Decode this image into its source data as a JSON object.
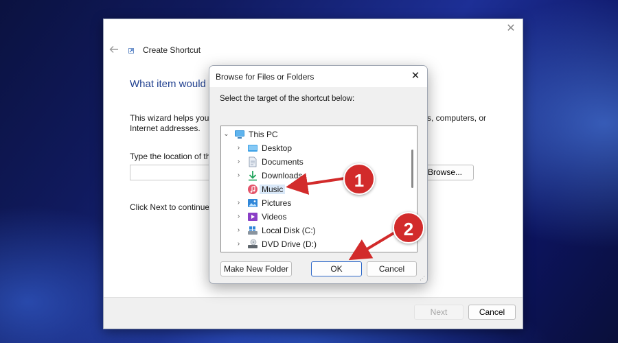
{
  "wizard": {
    "title": "Create Shortcut",
    "heading": "What item would you like to create a shortcut for?",
    "description_line1": "This wizard helps you t",
    "description_line1_right": "s, computers, or",
    "description_line2": "Internet addresses.",
    "location_label": "Type the location of the item:",
    "location_value": "",
    "browse_label": "Browse...",
    "next_instruction": "Click Next to continue.",
    "next_label": "Next",
    "cancel_label": "Cancel"
  },
  "dialog": {
    "title": "Browse for Files or Folders",
    "instruction": "Select the target of the shortcut below:",
    "tree": [
      {
        "label": "This PC",
        "icon": "this-pc-icon",
        "expanded": true,
        "level": 0
      },
      {
        "label": "Desktop",
        "icon": "desktop-folder-icon",
        "expanded": false,
        "level": 1
      },
      {
        "label": "Documents",
        "icon": "documents-folder-icon",
        "expanded": false,
        "level": 1
      },
      {
        "label": "Downloads",
        "icon": "downloads-folder-icon",
        "expanded": false,
        "level": 1
      },
      {
        "label": "Music",
        "icon": "music-folder-icon",
        "expanded": false,
        "level": 1,
        "selected": true
      },
      {
        "label": "Pictures",
        "icon": "pictures-folder-icon",
        "expanded": false,
        "level": 1
      },
      {
        "label": "Videos",
        "icon": "videos-folder-icon",
        "expanded": false,
        "level": 1
      },
      {
        "label": "Local Disk (C:)",
        "icon": "local-disk-icon",
        "expanded": false,
        "level": 1
      },
      {
        "label": "DVD Drive (D:)",
        "icon": "dvd-drive-icon",
        "expanded": false,
        "level": 1
      }
    ],
    "make_folder_label": "Make New Folder",
    "ok_label": "OK",
    "cancel_label": "Cancel"
  },
  "annotations": {
    "step1": "1",
    "step2": "2",
    "color": "#d22b2b"
  }
}
